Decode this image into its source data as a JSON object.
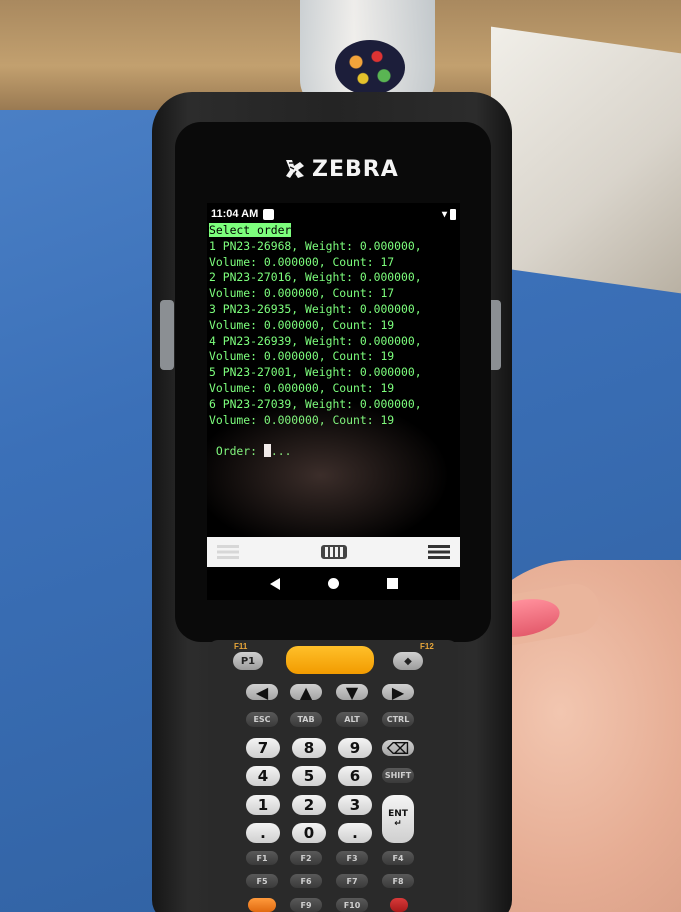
{
  "device": {
    "brand": "ZEBRA",
    "status_bar": {
      "time": "11:04 AM"
    }
  },
  "terminal": {
    "header": "Select order",
    "orders": [
      {
        "line1": "1 PN23-26968, Weight: 0.000000,",
        "line2": "Volume: 0.000000, Count: 17"
      },
      {
        "line1": "2 PN23-27016, Weight: 0.000000,",
        "line2": "Volume: 0.000000, Count: 17"
      },
      {
        "line1": "3 PN23-26935, Weight: 0.000000,",
        "line2": "Volume: 0.000000, Count: 19"
      },
      {
        "line1": "4 PN23-26939, Weight: 0.000000,",
        "line2": "Volume: 0.000000, Count: 19"
      },
      {
        "line1": "5 PN23-27001, Weight: 0.000000,",
        "line2": "Volume: 0.000000, Count: 19"
      },
      {
        "line1": "6 PN23-27039, Weight: 0.000000,",
        "line2": "Volume: 0.000000, Count: 19"
      }
    ],
    "prompt": "Order:",
    "input_suffix": "..."
  },
  "keypad": {
    "top_labels": {
      "f11": "F11",
      "f12": "F12"
    },
    "p1": "P1",
    "row_mod": [
      "ESC",
      "TAB",
      "ALT",
      "CTRL"
    ],
    "row_7": [
      "7",
      "8",
      "9"
    ],
    "row_4": [
      "4",
      "5",
      "6",
      "SHIFT"
    ],
    "row_1": [
      "1",
      "2",
      "3"
    ],
    "row_0": [
      ".",
      "0",
      "."
    ],
    "ent": "ENT",
    "row_f1": [
      "F1",
      "F2",
      "F3",
      "F4"
    ],
    "row_f5": [
      "F5",
      "F6",
      "F7",
      "F8"
    ],
    "row_f9": [
      "F9",
      "F10"
    ]
  }
}
